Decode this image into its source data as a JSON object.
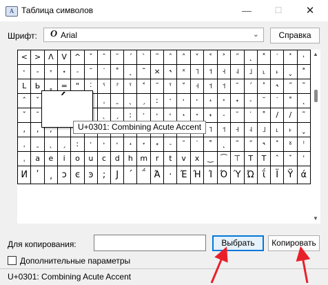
{
  "window": {
    "title": "Таблица символов",
    "icon_text": "A",
    "minimize": "—",
    "maximize": "☐",
    "close": "✕"
  },
  "font_row": {
    "label": "Шрифт:",
    "icon": "O",
    "value": "Arial",
    "chevron": "⌄",
    "help_label": "Справка"
  },
  "grid": {
    "rows": [
      [
        "<",
        ">",
        "Λ",
        "V",
        "^",
        "ˇ",
        "ˉ",
        "˘",
        "ˊ",
        "ˋ",
        "˜",
        "ˆ",
        "˄",
        "˅",
        "˂",
        "˃",
        "˝",
        "˛",
        "˚",
        "˙",
        "˟",
        "˒"
      ],
      [
        "˓",
        "-",
        "˕",
        "˖",
        "˗",
        "˘",
        "˙",
        "˚",
        "˛",
        "˜",
        "×",
        "˞",
        "ˣ",
        "˥",
        "˦",
        "˧",
        "˨",
        "˩",
        "˪",
        "˫",
        "ˬ",
        "˭"
      ],
      [
        "L",
        "Ь",
        "˳",
        "=",
        "\"",
        "˸",
        "ˁ",
        "ˀ",
        "ˁ",
        "˂",
        "ˉ",
        "ˁ",
        "˅",
        "˧",
        "˦",
        "˦",
        "ˉ",
        "ˊ",
        "˟",
        "˞",
        "˝",
        "˜"
      ],
      [
        "ˆ",
        "ˇ",
        "ˈ",
        "ˉ",
        "ˊ",
        "ˋ",
        "ˌ",
        "ˍ",
        "ˎ",
        "ˏ",
        "ː",
        "ˑ",
        "˒",
        "˓",
        "˔",
        "˕",
        "˖",
        "˗",
        "˘",
        "˙",
        "˚",
        "˛"
      ],
      [
        "ˇ",
        "ˉ",
        "ˊ",
        "ˋ",
        "ˌ",
        "ˍ",
        "ˎ",
        "ˏ",
        "ː",
        "ˑ",
        "˒",
        "˓",
        "˔",
        "˕",
        "˖",
        "˗",
        "˘",
        "˙",
        "˚",
        "/",
        "/",
        "˜"
      ],
      [
        ",",
        ",",
        ",",
        "ˆ",
        "ˇ",
        "ˈ",
        "˝",
        "˞",
        "˟",
        "ˠ",
        "ˡ",
        "ˢ",
        "ˣ",
        "ˤ",
        "˥",
        "˦",
        "˧",
        "˨",
        "˩",
        "˪",
        "˫",
        "ˬ"
      ],
      [
        "ˌ",
        "ˍ",
        "ˎ",
        "ˏ",
        "ː",
        "ˑ",
        "˒",
        "˓",
        "˔",
        "˕",
        "˖",
        "˗",
        "˘",
        "˙",
        "˚",
        "˛",
        "˜",
        "˝",
        "˞",
        "˟",
        "ˠ",
        "ˡ"
      ],
      [
        "ˌ",
        "a",
        "e",
        "i",
        "o",
        "u",
        "c",
        "d",
        "h",
        "m",
        "r",
        "t",
        "v",
        "x",
        "‿",
        "͡",
        "⊤",
        "T",
        "T",
        "ˆ",
        "ˇ",
        "ˈ"
      ],
      [
        "И",
        "ʹ",
        "͵",
        "ͻ",
        "ͼ",
        "ͽ",
        ";",
        "Ϳ",
        "΄",
        "΅",
        "Ά",
        "·",
        "Έ",
        "Ή",
        "Ί",
        "Ό",
        "Ύ",
        "Ώ",
        "ΐ",
        "Ϊ",
        "Ϋ",
        "ά"
      ]
    ]
  },
  "popup": {
    "char": "́"
  },
  "tooltip": {
    "text": "U+0301: Combining Acute Accent"
  },
  "copy_row": {
    "label": "Для копирования:",
    "input_value": "",
    "select_label": "Выбрать",
    "copy_label": "Копировать"
  },
  "advanced": {
    "label": "Дополнительные параметры"
  },
  "status": {
    "text": "U+0301: Combining Acute Accent"
  },
  "colors": {
    "arrow": "#e8202a",
    "focus": "#0078d7"
  }
}
